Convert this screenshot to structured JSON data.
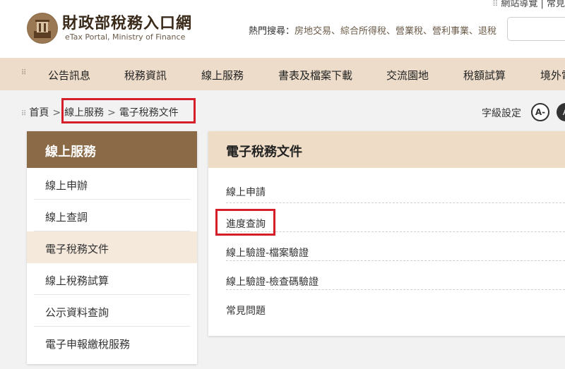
{
  "header": {
    "top_links": "網站導覽 | 常見",
    "logo_zh": "財政部稅務入口網",
    "logo_en": "eTax Portal, Ministry of Finance",
    "hot_label": "熱門搜尋：",
    "hot_terms": "房地交易、綜合所得稅、營業稅、營利事業、退稅"
  },
  "nav": {
    "items": [
      "公告訊息",
      "稅務資訊",
      "線上服務",
      "書表及檔案下載",
      "交流園地",
      "稅額試算",
      "境外電"
    ]
  },
  "breadcrumb": {
    "home": "首頁",
    "sep": ">",
    "level1": "線上服務",
    "level2": "電子稅務文件"
  },
  "font_setting": {
    "label": "字級設定",
    "small": "A-",
    "large": "A"
  },
  "sidebar": {
    "title": "線上服務",
    "items": [
      "線上申辦",
      "線上查調",
      "電子稅務文件",
      "線上稅務試算",
      "公示資料查詢",
      "電子申報繳稅服務"
    ],
    "active_index": 2
  },
  "panel": {
    "title": "電子稅務文件",
    "items": [
      "線上申請",
      "進度查詢",
      "線上驗證-檔案驗證",
      "線上驗證-檢查碼驗證",
      "常見問題"
    ]
  },
  "colors": {
    "nav_bg": "#ecdcc9",
    "sidebar_head": "#8b6a48",
    "panel_head": "#eedcc6",
    "highlight": "#d41e2a"
  }
}
